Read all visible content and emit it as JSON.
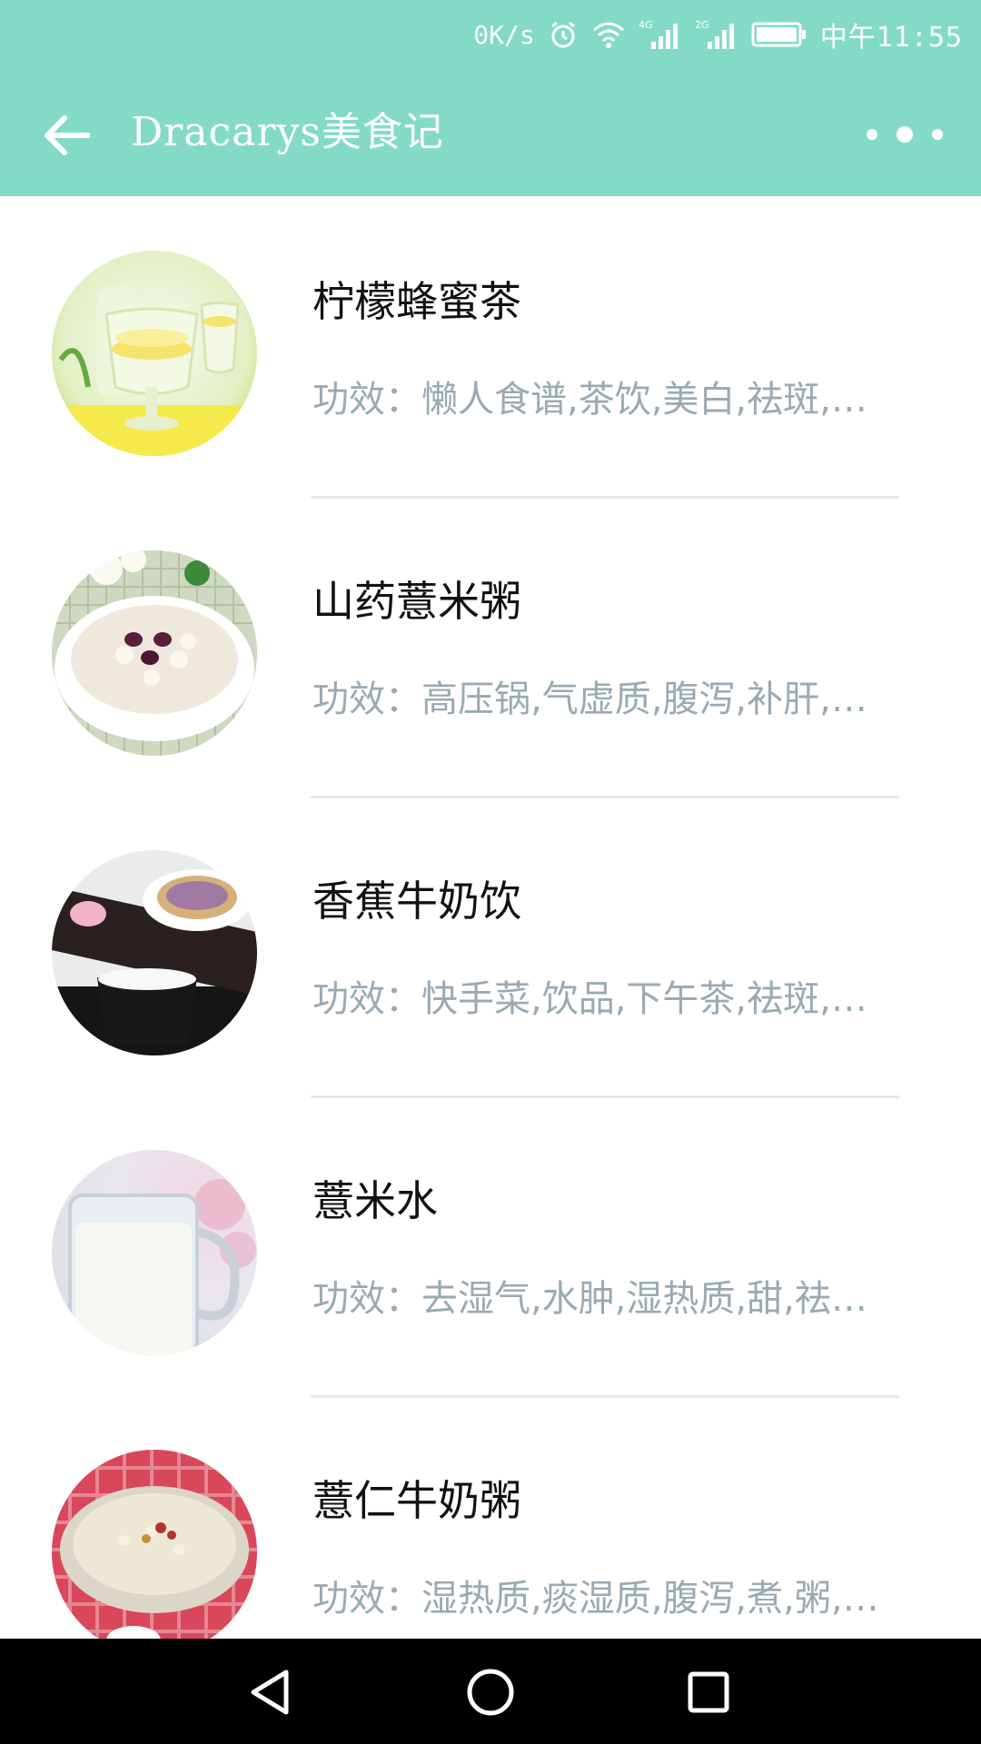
{
  "status_bar": {
    "network_speed": "0K/s",
    "time": "中午11:55",
    "icons": [
      "alarm-icon",
      "wifi-icon",
      "signal-4g-icon",
      "signal-2g-icon",
      "battery-icon"
    ],
    "signal_4g_label": "4G",
    "signal_2g_label": "2G"
  },
  "app_bar": {
    "title": "Dracarys美食记",
    "back_icon": "arrow-back-icon",
    "more_icon": "more-dots-icon"
  },
  "recipes": [
    {
      "name": "柠檬蜂蜜茶",
      "effect": "功效：懒人食谱,茶饮,美白,祛斑,…"
    },
    {
      "name": "山药薏米粥",
      "effect": "功效：高压锅,气虚质,腹泻,补肝,…"
    },
    {
      "name": "香蕉牛奶饮",
      "effect": "功效：快手菜,饮品,下午茶,祛斑,…"
    },
    {
      "name": "薏米水",
      "effect": "功效：去湿气,水肿,湿热质,甜,祛…"
    },
    {
      "name": "薏仁牛奶粥",
      "effect": "功效：湿热质,痰湿质,腹泻,煮,粥,…"
    }
  ],
  "colors": {
    "accent": "#84dbc5",
    "effect_text": "#9aaab3",
    "divider": "#e8e8e8",
    "nav_bar": "#000000"
  },
  "nav_bar": {
    "icons": [
      "back-triangle-icon",
      "home-circle-icon",
      "recents-square-icon"
    ]
  }
}
